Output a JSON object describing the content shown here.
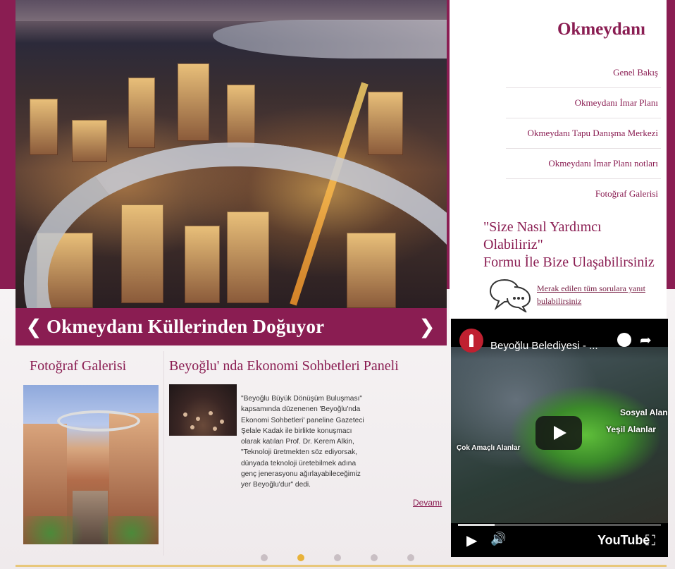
{
  "slider": {
    "title": "Okmeydanı Küllerinden Doğuyor",
    "prev_icon": "chevron-left-icon",
    "next_icon": "chevron-right-icon",
    "prev": "❮",
    "next": "❯",
    "active_dot": 2,
    "dot_count": 5
  },
  "sidebar": {
    "title": "Okmeydanı",
    "items": [
      {
        "label": "Genel Bakış"
      },
      {
        "label": "Okmeydanı İmar Planı"
      },
      {
        "label": "Okmeydanı Tapu Danışma Merkezi"
      },
      {
        "label": "Okmeydanı İmar Planı notları"
      },
      {
        "label": "Fotoğraf Galerisi"
      }
    ],
    "help_line1": "\"Size Nasıl Yardımcı Olabiliriz\"",
    "help_line2": "Formu İle Bize Ulaşabilirsiniz",
    "faq_icon": "speech-bubbles-icon",
    "faq_link": "Merak edilen tüm sorulara yanıt bulabilirsiniz"
  },
  "gallery": {
    "heading": "Fotoğraf Galerisi"
  },
  "news": {
    "heading": "Beyoğlu' nda Ekonomi Sohbetleri Paneli",
    "body": "\"Beyoğlu Büyük Dönüşüm Buluşması\" kapsamında düzenenen 'Beyoğlu'nda Ekonomi Sohbetleri' paneline Gazeteci Şelale Kadak ile birlikte konuşmacı olarak katılan Prof. Dr. Kerem Alkin, \"Teknoloji üretmekten söz ediyorsak, dünyada teknoloji üretebilmek adına genç jenerasyonu ağırlayabileceğimiz yer Beyoğlu'dur\" dedi.",
    "more": "Devamı"
  },
  "video": {
    "channel_title": "Beyoğlu Belediyesi - ...",
    "overlay_label_1": "Sosyal Alan",
    "overlay_label_2": "Yeşil Alanlar",
    "overlay_label_3": "Çok Amaçlı Alanlar",
    "brand": "YouTube",
    "progress": 0.18,
    "play_icon": "play-icon",
    "volume_icon": "volume-icon",
    "fullscreen_icon": "fullscreen-icon",
    "share_icon": "share-icon",
    "watch_later_icon": "clock-icon",
    "play_glyph": "▶",
    "volume_glyph": "🔊",
    "fullscreen_glyph": "⛶",
    "share_glyph": "➦"
  },
  "colors": {
    "brand": "#8a1d52",
    "accent": "#e8b23a"
  }
}
